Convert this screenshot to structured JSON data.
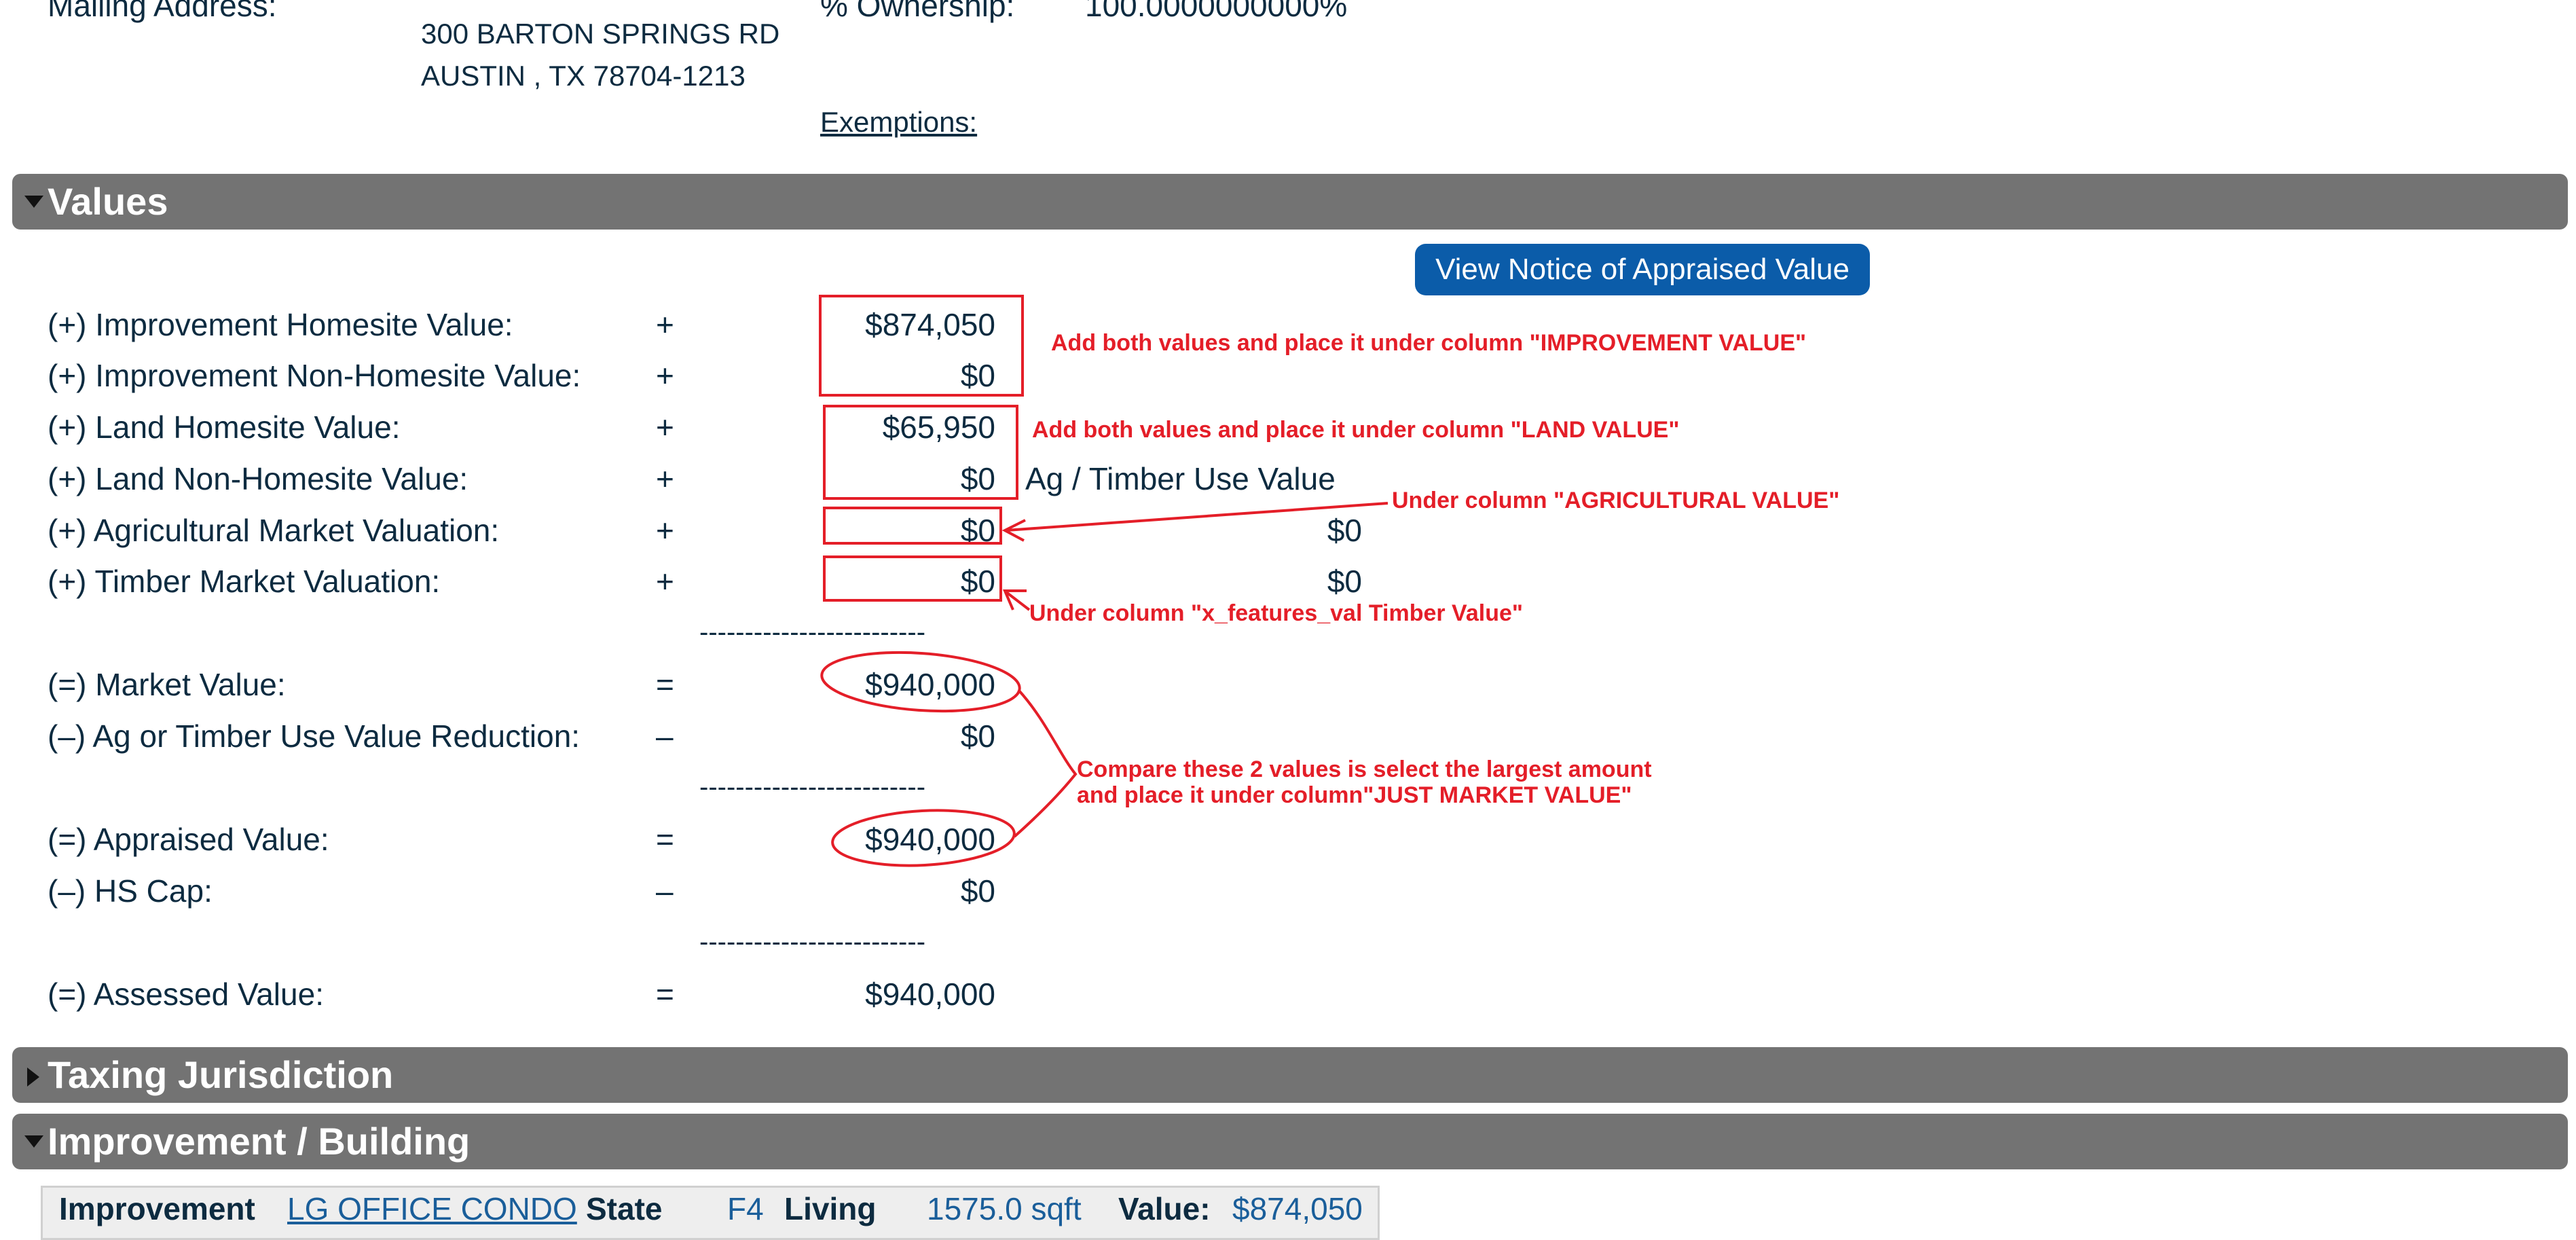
{
  "owner": {
    "mailing_label": "Mailing Address:",
    "address_line1": "300 BARTON SPRINGS RD",
    "address_line2": "AUSTIN , TX 78704-1213",
    "ownership_label": "% Ownership:",
    "ownership_value": "100.0000000000%",
    "exemptions_label": "Exemptions:"
  },
  "sections": {
    "values_title": "Values",
    "taxing_title": "Taxing Jurisdiction",
    "improvement_title": "Improvement / Building"
  },
  "notice_button_label": "View Notice of Appraised Value",
  "values_rows": [
    {
      "label": "(+) Improvement Homesite Value:",
      "op": "+",
      "value": "$874,050"
    },
    {
      "label": "(+) Improvement Non-Homesite Value:",
      "op": "+",
      "value": "$0"
    },
    {
      "label": "(+) Land Homesite Value:",
      "op": "+",
      "value": "$65,950"
    },
    {
      "label": "(+) Land Non-Homesite Value:",
      "op": "+",
      "value": "$0"
    },
    {
      "label": "(+) Agricultural Market Valuation:",
      "op": "+",
      "value": "$0",
      "use_value": "$0"
    },
    {
      "label": "(+) Timber Market Valuation:",
      "op": "+",
      "value": "$0",
      "use_value": "$0"
    },
    {
      "label": "(=) Market Value:",
      "op": "=",
      "value": "$940,000"
    },
    {
      "label": "(–) Ag or Timber Use Value Reduction:",
      "op": "–",
      "value": "$0"
    },
    {
      "label": "(=) Appraised Value:",
      "op": "=",
      "value": "$940,000"
    },
    {
      "label": "(–) HS Cap:",
      "op": "–",
      "value": "$0"
    },
    {
      "label": "(=) Assessed Value:",
      "op": "=",
      "value": "$940,000"
    }
  ],
  "ag_timber_header": "Ag / Timber Use Value",
  "separator": "-------------------------",
  "annotations": {
    "improvement": "Add both values and place it under column \"IMPROVEMENT VALUE\"",
    "land": "Add both values and place it under column \"LAND VALUE\"",
    "agricultural": "Under column \"AGRICULTURAL VALUE\"",
    "timber": "Under column \"x_features_val Timber Value\"",
    "compare_line1": "Compare these 2 values is select the largest amount",
    "compare_line2": "and place it under column\"JUST MARKET VALUE\"",
    "color": "#e41e28"
  },
  "improvement_bar": {
    "improvement_label": "Improvement",
    "improvement_value": "LG OFFICE CONDO",
    "state_label": "State",
    "state_value": "F4",
    "living_label": "Living",
    "living_value": "1575.0 sqft",
    "value_label": "Value:",
    "value_value": "$874,050"
  },
  "colors": {
    "header_bg": "#737373",
    "button_bg": "#0b5ca9",
    "text": "#0d2b40"
  }
}
